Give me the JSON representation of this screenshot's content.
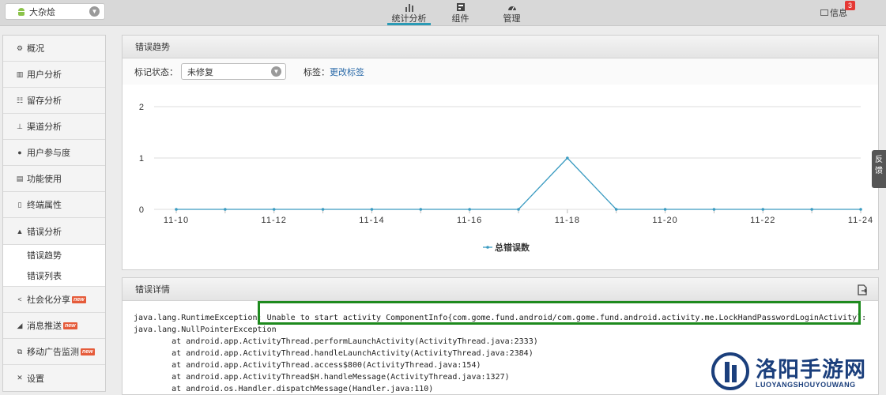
{
  "topbar": {
    "app_name": "大杂烩",
    "nav": [
      {
        "label": "统计分析",
        "icon": "bar-chart-icon",
        "active": true
      },
      {
        "label": "组件",
        "icon": "component-icon",
        "active": false
      },
      {
        "label": "管理",
        "icon": "dashboard-icon",
        "active": false
      }
    ],
    "message_label": "信息",
    "message_count": "3"
  },
  "sidebar": {
    "items": [
      {
        "label": "概况",
        "icon": "gear-icon"
      },
      {
        "label": "用户分析",
        "icon": "bar-chart-icon"
      },
      {
        "label": "留存分析",
        "icon": "retention-icon"
      },
      {
        "label": "渠道分析",
        "icon": "channel-icon"
      },
      {
        "label": "用户参与度",
        "icon": "user-icon"
      },
      {
        "label": "功能使用",
        "icon": "document-icon"
      },
      {
        "label": "终端属性",
        "icon": "device-icon"
      },
      {
        "label": "错误分析",
        "icon": "warning-icon",
        "active": true
      }
    ],
    "sub_items": [
      "错误趋势",
      "错误列表"
    ],
    "items_after": [
      {
        "label": "社会化分享",
        "icon": "share-icon",
        "new": "new"
      },
      {
        "label": "消息推送",
        "icon": "send-icon",
        "new": "new"
      },
      {
        "label": "移动广告监测",
        "icon": "ad-monitor-icon",
        "new": "new"
      },
      {
        "label": "设置",
        "icon": "tools-icon"
      }
    ]
  },
  "trend_panel": {
    "title": "错误趋势",
    "status_label": "标记状态：",
    "status_value": "未修复",
    "tag_label": "标签：",
    "tag_link": "更改标签"
  },
  "chart_data": {
    "type": "line",
    "title": "",
    "xlabel": "",
    "ylabel": "",
    "x": [
      "11-10",
      "11-11",
      "11-12",
      "11-13",
      "11-14",
      "11-15",
      "11-16",
      "11-17",
      "11-18",
      "11-19",
      "11-20",
      "11-21",
      "11-22",
      "11-23",
      "11-24"
    ],
    "tick_labels": [
      "11-10",
      "11-12",
      "11-14",
      "11-16",
      "11-18",
      "11-20",
      "11-22",
      "11-24"
    ],
    "y_ticks": [
      "0",
      "1",
      "2"
    ],
    "ylim": [
      0,
      2
    ],
    "series": [
      {
        "name": "总错误数",
        "color": "#3a9bc1",
        "values": [
          0,
          0,
          0,
          0,
          0,
          0,
          0,
          0,
          1,
          0,
          0,
          0,
          0,
          0,
          0
        ]
      }
    ],
    "grid": true,
    "legend_position": "bottom-center"
  },
  "detail_panel": {
    "title": "错误详情",
    "stack_lines": [
      "java.lang.RuntimeException: Unable to start activity ComponentInfo{com.gome.fund.android/com.gome.fund.android.activity.me.LockHandPasswordLoginActivity}:",
      "java.lang.NullPointerException",
      "        at android.app.ActivityThread.performLaunchActivity(ActivityThread.java:2333)",
      "        at android.app.ActivityThread.handleLaunchActivity(ActivityThread.java:2384)",
      "        at android.app.ActivityThread.access$800(ActivityThread.java:154)",
      "        at android.app.ActivityThread$H.handleMessage(ActivityThread.java:1327)",
      "        at android.os.Handler.dispatchMessage(Handler.java:110)"
    ]
  },
  "feedback_label": "反馈",
  "watermark": {
    "cn": "洛阳手游网",
    "en": "LUOYANGSHOUYOUWANG"
  }
}
